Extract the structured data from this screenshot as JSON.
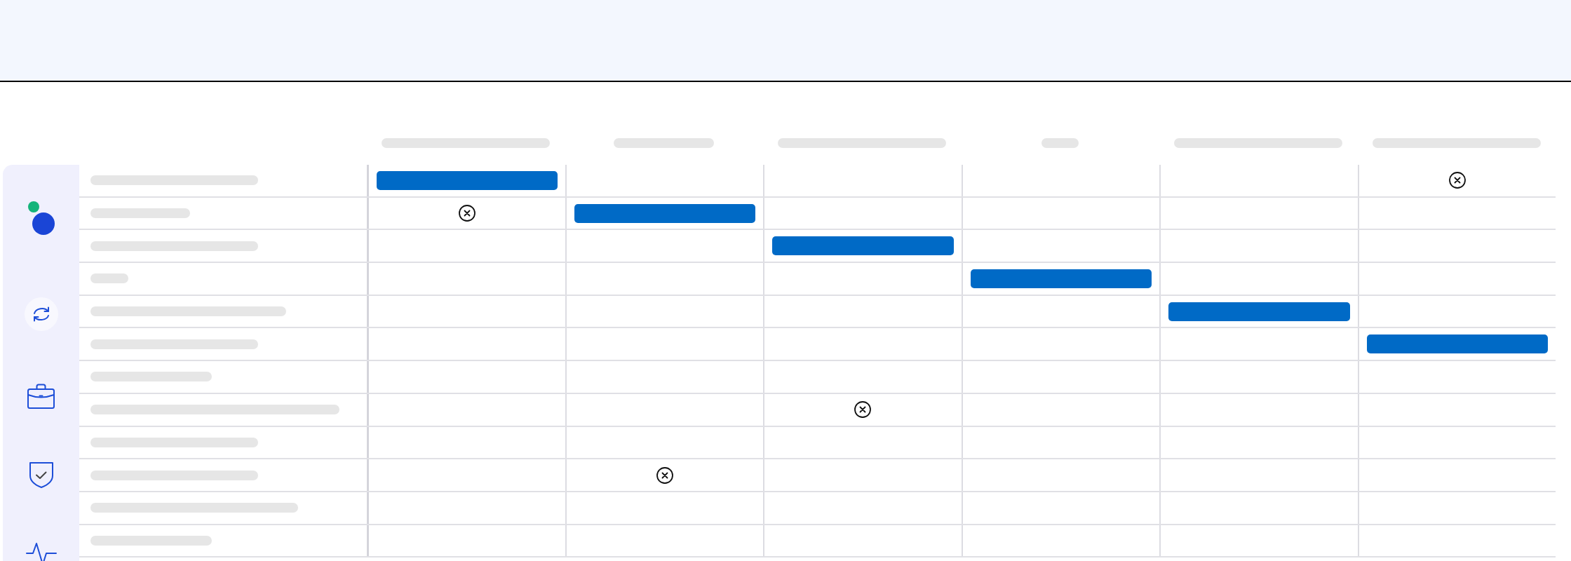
{
  "sidebar": {
    "user": {
      "online": true
    }
  },
  "table": {
    "rows": [
      {
        "cells": [
          {
            "kind": "bar"
          },
          {
            "kind": "empty"
          },
          {
            "kind": "empty"
          },
          {
            "kind": "empty"
          },
          {
            "kind": "empty"
          },
          {
            "kind": "cross"
          }
        ]
      },
      {
        "cells": [
          {
            "kind": "cross"
          },
          {
            "kind": "bar"
          },
          {
            "kind": "empty"
          },
          {
            "kind": "empty"
          },
          {
            "kind": "empty"
          },
          {
            "kind": "empty"
          }
        ]
      },
      {
        "cells": [
          {
            "kind": "empty"
          },
          {
            "kind": "empty"
          },
          {
            "kind": "bar"
          },
          {
            "kind": "empty"
          },
          {
            "kind": "empty"
          },
          {
            "kind": "empty"
          }
        ]
      },
      {
        "cells": [
          {
            "kind": "empty"
          },
          {
            "kind": "empty"
          },
          {
            "kind": "empty"
          },
          {
            "kind": "bar"
          },
          {
            "kind": "empty"
          },
          {
            "kind": "empty"
          }
        ]
      },
      {
        "cells": [
          {
            "kind": "empty"
          },
          {
            "kind": "empty"
          },
          {
            "kind": "empty"
          },
          {
            "kind": "empty"
          },
          {
            "kind": "bar"
          },
          {
            "kind": "empty"
          }
        ]
      },
      {
        "cells": [
          {
            "kind": "empty"
          },
          {
            "kind": "empty"
          },
          {
            "kind": "empty"
          },
          {
            "kind": "empty"
          },
          {
            "kind": "empty"
          },
          {
            "kind": "bar"
          }
        ]
      },
      {
        "cells": [
          {
            "kind": "empty"
          },
          {
            "kind": "empty"
          },
          {
            "kind": "empty"
          },
          {
            "kind": "empty"
          },
          {
            "kind": "empty"
          },
          {
            "kind": "empty"
          }
        ]
      },
      {
        "cells": [
          {
            "kind": "empty"
          },
          {
            "kind": "empty"
          },
          {
            "kind": "cross"
          },
          {
            "kind": "empty"
          },
          {
            "kind": "empty"
          },
          {
            "kind": "empty"
          }
        ]
      },
      {
        "cells": [
          {
            "kind": "empty"
          },
          {
            "kind": "empty"
          },
          {
            "kind": "empty"
          },
          {
            "kind": "empty"
          },
          {
            "kind": "empty"
          },
          {
            "kind": "empty"
          }
        ]
      },
      {
        "cells": [
          {
            "kind": "empty"
          },
          {
            "kind": "cross"
          },
          {
            "kind": "empty"
          },
          {
            "kind": "empty"
          },
          {
            "kind": "empty"
          },
          {
            "kind": "empty"
          }
        ]
      },
      {
        "cells": [
          {
            "kind": "empty"
          },
          {
            "kind": "empty"
          },
          {
            "kind": "empty"
          },
          {
            "kind": "empty"
          },
          {
            "kind": "empty"
          },
          {
            "kind": "empty"
          }
        ]
      },
      {
        "cells": [
          {
            "kind": "empty"
          },
          {
            "kind": "empty"
          },
          {
            "kind": "empty"
          },
          {
            "kind": "empty"
          },
          {
            "kind": "empty"
          },
          {
            "kind": "empty"
          }
        ]
      }
    ]
  }
}
